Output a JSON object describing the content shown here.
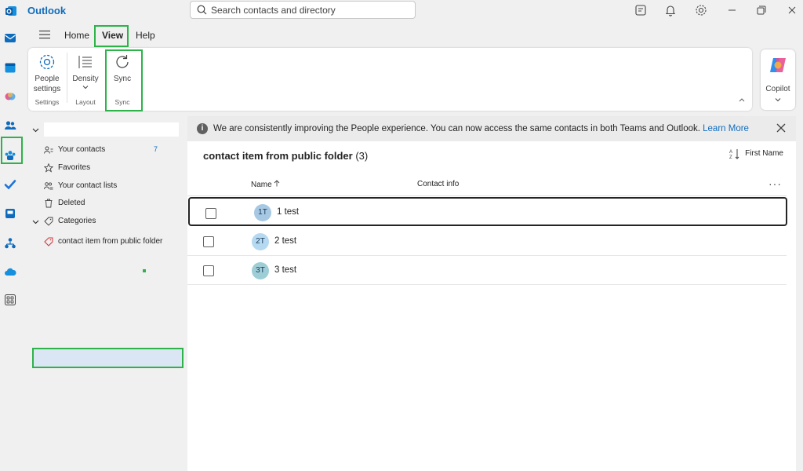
{
  "app": {
    "name": "Outlook"
  },
  "search": {
    "placeholder": "Search contacts and directory"
  },
  "menu": {
    "home": "Home",
    "view": "View",
    "help": "Help"
  },
  "ribbon": {
    "people_settings_line1": "People",
    "people_settings_line2": "settings",
    "settings_group": "Settings",
    "density": "Density",
    "layout_group": "Layout",
    "sync": "Sync",
    "sync_group": "Sync",
    "copilot": "Copilot"
  },
  "sidebar": {
    "items": [
      {
        "label": "Your contacts",
        "count": "7",
        "icon": "contacts-icon"
      },
      {
        "label": "Favorites",
        "icon": "star-icon"
      },
      {
        "label": "Your contact lists",
        "icon": "contact-lists-icon"
      },
      {
        "label": "Deleted",
        "icon": "trash-icon"
      },
      {
        "label": "Categories",
        "icon": "tag-icon"
      },
      {
        "label": "contact item from public folder",
        "icon": "category-tag-icon"
      }
    ]
  },
  "banner": {
    "message": "We are consistently improving the People experience. You can now access the same contacts in both Teams and Outlook.",
    "link": "Learn More"
  },
  "folder": {
    "title": "contact item from public folder",
    "count": "(3)"
  },
  "sort": {
    "label": "First Name"
  },
  "columns": {
    "name": "Name",
    "contact_info": "Contact info"
  },
  "contacts": [
    {
      "initials": "1T",
      "name": "1 test",
      "color": "#a7c8e3"
    },
    {
      "initials": "2T",
      "name": "2 test",
      "color": "#b5d9f0"
    },
    {
      "initials": "3T",
      "name": "3 test",
      "color": "#9ecdd6"
    }
  ],
  "colors": {
    "accent": "#0f6cbd",
    "highlight": "#2db34a",
    "selected": "#dbe6f5"
  }
}
